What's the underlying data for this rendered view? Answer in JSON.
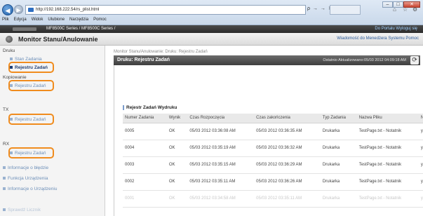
{
  "browser": {
    "url": "http://192.168.222.54/rs_plist.html",
    "addr_tools": "ρ → → ✕",
    "menu": [
      "Plik",
      "Edycja",
      "Widok",
      "Ulubione",
      "Narzędzia",
      "Pomoc"
    ]
  },
  "header": {
    "model": "MF8500C Series / MF8500C Series /",
    "right": "Do Portalu   Wyloguj się",
    "title": "Monitor Stanu/Anulowanie",
    "links": "Wiadomość do Menedżera Systemu   Pomoc"
  },
  "sidebar": {
    "druk_head": "Druku",
    "druk_items": [
      "Stan Zadania",
      "Rejestru Zadań"
    ],
    "kop_head": "Kopiowanie",
    "kop_item": "Rejestru Zadań",
    "tx_head": "TX",
    "tx_item": "Rejestru Zadań",
    "rx_head": "RX",
    "rx_item": "Rejestru Zadań",
    "extra": [
      "Informacje o błędzie",
      "Funkcja Urządzenia",
      "Informacje o Urządzeniu",
      "Sprawdź Licznik"
    ]
  },
  "main": {
    "breadcrumb": "Monitor Stanu/Anulowanie: Druku: Rejestru Zadań",
    "panel_title": "Druku: Rejestru Zadań",
    "updated": "Ostatnio Aktualizowano:05/03 2012 04:09:18 AM",
    "section_title": "Rejestr Zadań Wydruku",
    "columns": [
      "Numer Zadania",
      "Wynik",
      "Czas Rozpoczęcia",
      "Czas zakończenia",
      "Typ Zadania",
      "Nazwa Pliku",
      "Na"
    ],
    "rows": [
      [
        "0005",
        "OK",
        "05/03 2012 03:36:08 AM",
        "05/03 2012 03:36:35 AM",
        "Drukarka",
        "TestPage.txt - Notatnik",
        "yit"
      ],
      [
        "0004",
        "OK",
        "05/03 2012 03:35:19 AM",
        "05/03 2012 03:36:32 AM",
        "Drukarka",
        "TestPage.txt - Notatnik",
        "yit"
      ],
      [
        "0003",
        "OK",
        "05/03 2012 03:35:15 AM",
        "05/03 2012 03:36:29 AM",
        "Drukarka",
        "TestPage.txt - Notatnik",
        "yit"
      ],
      [
        "0002",
        "OK",
        "05/03 2012 03:35:11 AM",
        "05/03 2012 03:36:26 AM",
        "Drukarka",
        "TestPage.txt - Notatnik",
        "yit"
      ],
      [
        "0001",
        "OK",
        "05/03 2012 03:34:58 AM",
        "05/03 2012 03:35:11 AM",
        "Drukarka",
        "TestPage.txt - Notatnik",
        "yit"
      ]
    ]
  },
  "colors": {
    "highlight": "#f08c1e",
    "accent": "#1f3e73"
  }
}
